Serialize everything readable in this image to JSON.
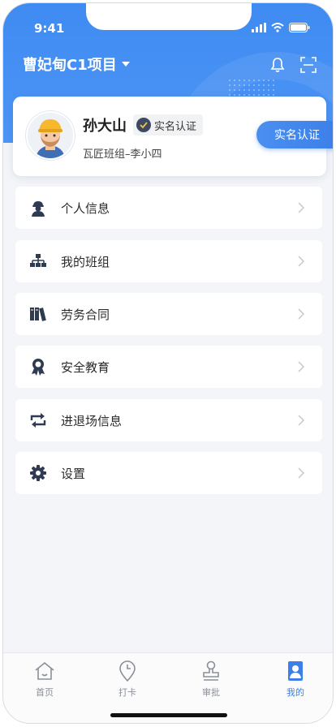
{
  "status_bar": {
    "time": "9:41"
  },
  "header": {
    "project_name": "曹妃甸C1项目"
  },
  "profile": {
    "name": "孙大山",
    "verify_tag": "实名认证",
    "team": "瓦匠班组–李小四",
    "verify_button": "实名认证"
  },
  "menu": [
    {
      "label": "个人信息",
      "icon": "worker-icon"
    },
    {
      "label": "我的班组",
      "icon": "org-chart-icon"
    },
    {
      "label": "劳务合同",
      "icon": "books-icon"
    },
    {
      "label": "安全教育",
      "icon": "award-icon"
    },
    {
      "label": "进退场信息",
      "icon": "swap-icon"
    },
    {
      "label": "设置",
      "icon": "gear-icon"
    }
  ],
  "tabbar": [
    {
      "label": "首页",
      "icon": "home-icon"
    },
    {
      "label": "打卡",
      "icon": "location-clock-icon"
    },
    {
      "label": "审批",
      "icon": "stamp-icon"
    },
    {
      "label": "我的",
      "icon": "user-icon",
      "active": true
    }
  ],
  "colors": {
    "accent": "#3d7fe8",
    "hero": "#4a90f3",
    "icon_dark": "#2f3b52"
  }
}
